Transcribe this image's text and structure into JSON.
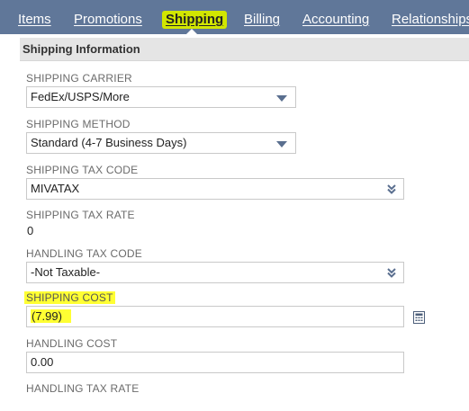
{
  "tabs": [
    {
      "label": "Items"
    },
    {
      "label": "Promotions"
    },
    {
      "label": "Shipping"
    },
    {
      "label": "Billing"
    },
    {
      "label": "Accounting"
    },
    {
      "label": "Relationships"
    }
  ],
  "section": {
    "title": "Shipping Information"
  },
  "fields": {
    "shipping_carrier": {
      "label": "SHIPPING CARRIER",
      "value": "FedEx/USPS/More"
    },
    "shipping_method": {
      "label": "SHIPPING METHOD",
      "value": "Standard (4-7 Business Days)"
    },
    "shipping_tax_code": {
      "label": "SHIPPING TAX CODE",
      "value": "MIVATAX"
    },
    "shipping_tax_rate": {
      "label": "SHIPPING TAX RATE",
      "value": "0"
    },
    "handling_tax_code": {
      "label": "HANDLING TAX CODE",
      "value": "-Not Taxable-"
    },
    "shipping_cost": {
      "label": "SHIPPING COST",
      "value": "(7.99)"
    },
    "handling_cost": {
      "label": "HANDLING COST",
      "value": "0.00"
    },
    "handling_tax_rate": {
      "label": "HANDLING TAX RATE"
    }
  },
  "colors": {
    "tab_bar": "#607799",
    "highlight": "#ffff33",
    "active_tab_highlight": "#d2e600",
    "section_header": "#e5e5e5"
  },
  "icons": {
    "select_caret": "caret-down-icon",
    "multiselect_caret": "double-chevron-down-icon",
    "calculator": "calculator-icon"
  }
}
